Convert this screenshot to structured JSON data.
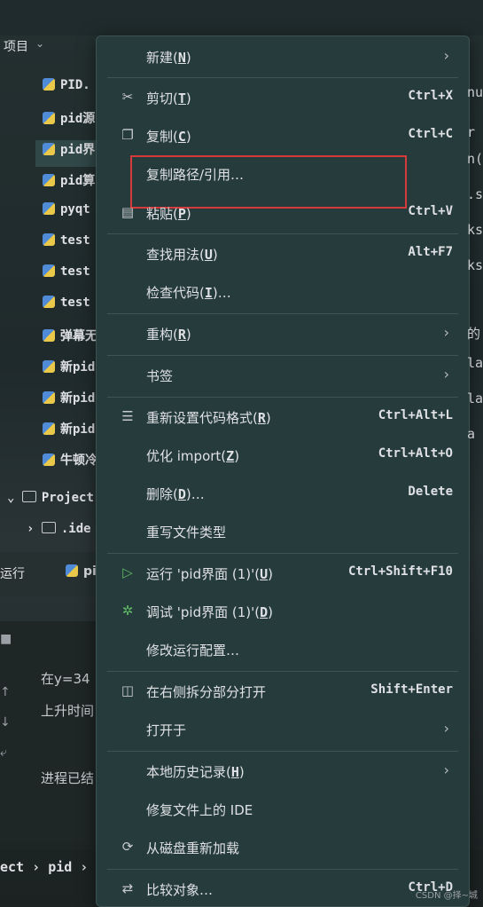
{
  "background": {
    "project_label": "项目",
    "tree": [
      "PID.",
      "pid源",
      "pid界",
      "pid算",
      "pyqt",
      "test",
      "test",
      "test",
      "弹幕无",
      "新pid",
      "新pid",
      "新pid",
      "牛顿冷"
    ],
    "folder_project": "Project",
    "folder_idea": ".ide",
    "run_label": "运行",
    "run_tab": "pi",
    "console": [
      "在y=34",
      "上升时间",
      "进程已结"
    ],
    "breadcrumb_project": "ect",
    "breadcrumb_pid": "pid",
    "right_code": [
      "nu",
      "r",
      "n(",
      ".s",
      "ks",
      "ks",
      "的",
      "la",
      "la",
      "a"
    ]
  },
  "menu": {
    "items": [
      {
        "label": "新建(",
        "mnemonic": "N",
        "end": ")",
        "shortcut": "",
        "submenu": true,
        "icon": ""
      },
      {
        "label": "剪切(",
        "mnemonic": "T",
        "end": ")",
        "shortcut": "Ctrl+X",
        "submenu": false,
        "icon": "scissors-icon"
      },
      {
        "label": "复制(",
        "mnemonic": "C",
        "end": ")",
        "shortcut": "Ctrl+C",
        "submenu": false,
        "icon": "copy-icon"
      },
      {
        "label": "复制路径/引用…",
        "mnemonic": "",
        "end": "",
        "shortcut": "",
        "submenu": false,
        "icon": ""
      },
      {
        "label": "粘贴(",
        "mnemonic": "P",
        "end": ")",
        "shortcut": "Ctrl+V",
        "submenu": false,
        "icon": "paste-icon"
      },
      {
        "label": "查找用法(",
        "mnemonic": "U",
        "end": ")",
        "shortcut": "Alt+F7",
        "submenu": false,
        "icon": ""
      },
      {
        "label": "检查代码(",
        "mnemonic": "I",
        "end": ")…",
        "shortcut": "",
        "submenu": false,
        "icon": ""
      },
      {
        "label": "重构(",
        "mnemonic": "R",
        "end": ")",
        "shortcut": "",
        "submenu": true,
        "icon": ""
      },
      {
        "label": "书签",
        "mnemonic": "",
        "end": "",
        "shortcut": "",
        "submenu": true,
        "icon": ""
      },
      {
        "label": "重新设置代码格式(",
        "mnemonic": "R",
        "end": ")",
        "shortcut": "Ctrl+Alt+L",
        "submenu": false,
        "icon": "format-icon"
      },
      {
        "label": "优化 import(",
        "mnemonic": "Z",
        "end": ")",
        "shortcut": "Ctrl+Alt+O",
        "submenu": false,
        "icon": ""
      },
      {
        "label": "删除(",
        "mnemonic": "D",
        "end": ")…",
        "shortcut": "Delete",
        "submenu": false,
        "icon": ""
      },
      {
        "label": "重写文件类型",
        "mnemonic": "",
        "end": "",
        "shortcut": "",
        "submenu": false,
        "icon": ""
      },
      {
        "label": "运行 'pid界面 (1)'(",
        "mnemonic": "U",
        "end": ")",
        "shortcut": "Ctrl+Shift+F10",
        "submenu": false,
        "icon": "run-icon"
      },
      {
        "label": "调试 'pid界面 (1)'(",
        "mnemonic": "D",
        "end": ")",
        "shortcut": "",
        "submenu": false,
        "icon": "debug-icon"
      },
      {
        "label": "修改运行配置…",
        "mnemonic": "",
        "end": "",
        "shortcut": "",
        "submenu": false,
        "icon": ""
      },
      {
        "label": "在右侧拆分部分打开",
        "mnemonic": "",
        "end": "",
        "shortcut": "Shift+Enter",
        "submenu": false,
        "icon": "split-icon"
      },
      {
        "label": "打开于",
        "mnemonic": "",
        "end": "",
        "shortcut": "",
        "submenu": true,
        "icon": ""
      },
      {
        "label": "本地历史记录(",
        "mnemonic": "H",
        "end": ")",
        "shortcut": "",
        "submenu": true,
        "icon": ""
      },
      {
        "label": "修复文件上的 IDE",
        "mnemonic": "",
        "end": "",
        "shortcut": "",
        "submenu": false,
        "icon": ""
      },
      {
        "label": "从磁盘重新加载",
        "mnemonic": "",
        "end": "",
        "shortcut": "",
        "submenu": false,
        "icon": "reload-icon"
      },
      {
        "label": "比较对象…",
        "mnemonic": "",
        "end": "",
        "shortcut": "Ctrl+D",
        "submenu": false,
        "icon": "compare-icon"
      }
    ]
  },
  "watermark": "CSDN @择~城",
  "colors": {
    "menu_bg": "#263b3b",
    "highlight_border": "#d63a3a"
  }
}
